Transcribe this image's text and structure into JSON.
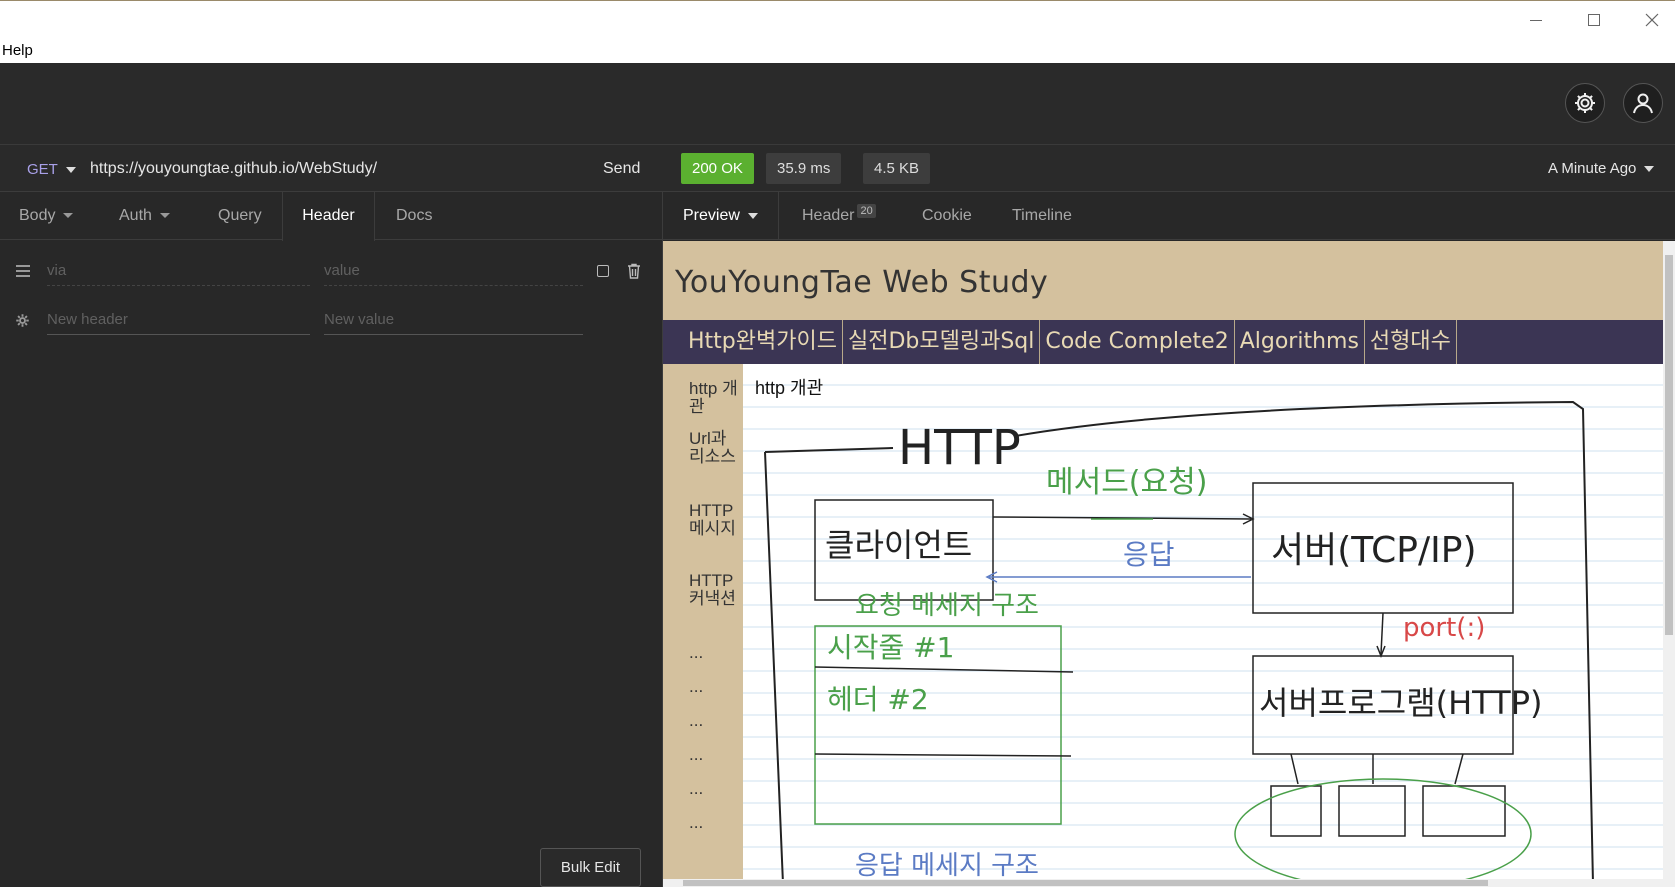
{
  "window": {
    "minimize": "—",
    "maximize": "☐",
    "close": "✕"
  },
  "menu": {
    "help": "Help"
  },
  "request": {
    "method": "GET",
    "url": "https://youyoungtae.github.io/WebStudy/",
    "send_label": "Send",
    "tabs": [
      "Body",
      "Auth",
      "Query",
      "Header",
      "Docs"
    ],
    "active_tab": "Header",
    "headers": [
      {
        "name_placeholder": "via",
        "value_placeholder": "value"
      },
      {
        "name_placeholder": "New header",
        "value_placeholder": "New value"
      }
    ],
    "bulk_edit_label": "Bulk Edit"
  },
  "response": {
    "status": "200 OK",
    "time": "35.9 ms",
    "size": "4.5 KB",
    "ago": "A Minute Ago",
    "tabs": {
      "preview": "Preview",
      "header": "Header",
      "header_count": "20",
      "cookie": "Cookie",
      "timeline": "Timeline"
    }
  },
  "site": {
    "title": "YouYoungTae Web Study",
    "nav": [
      "Http완벽가이드",
      "실전Db모델링과Sql",
      "Code Complete2",
      "Algorithms",
      "선형대수"
    ],
    "side": [
      "http 개관",
      "Url과 리소스",
      "HTTP 메시지",
      "HTTP 커낵션",
      "...",
      "...",
      "...",
      "...",
      "...",
      "..."
    ],
    "content_heading": "http 개관",
    "diagram": {
      "http": "HTTP",
      "client": "클라이언트",
      "server": "서버(TCP/IP)",
      "method": "메서드(요청)",
      "response": "응답",
      "request_structure": "요청 메세지 구조",
      "start_line": "시작줄 #1",
      "header": "헤더 #2",
      "port": "port(:)",
      "server_program": "서버프로그램(HTTP)",
      "response_structure": "응답 메세지 구조"
    }
  },
  "colors": {
    "status_ok": "#5bb030",
    "site_beige": "#d4c19e",
    "site_nav": "#3b3554",
    "method_purple": "#a8a0e8"
  }
}
